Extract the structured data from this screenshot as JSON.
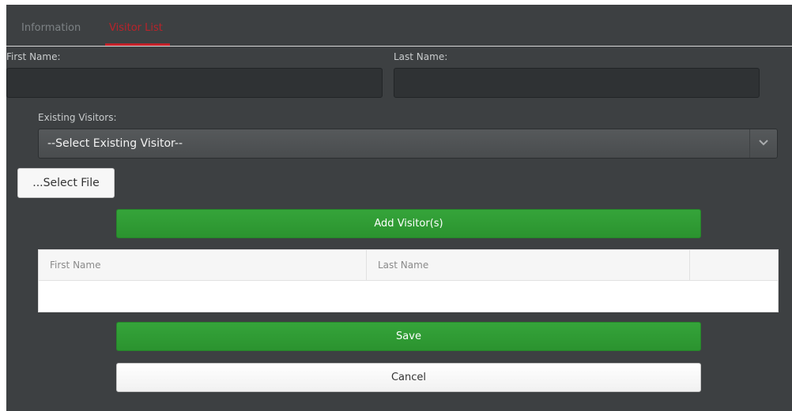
{
  "tabs": {
    "information": "Information",
    "visitor_list": "Visitor List",
    "active_color": "#c5222a"
  },
  "form": {
    "first_name_label": "First Name:",
    "first_name_value": "",
    "last_name_label": "Last Name:",
    "last_name_value": "",
    "existing_visitors_label": "Existing Visitors:",
    "existing_visitors_selected": "--Select Existing Visitor--",
    "select_file_label": "...Select File"
  },
  "actions": {
    "add_visitors_label": "Add Visitor(s)",
    "save_label": "Save",
    "cancel_label": "Cancel",
    "primary_color": "#2e9a33"
  },
  "table": {
    "columns": [
      "First Name",
      "Last Name",
      ""
    ],
    "rows": []
  },
  "icons": {
    "select_arrow": "chevron-down-icon"
  }
}
